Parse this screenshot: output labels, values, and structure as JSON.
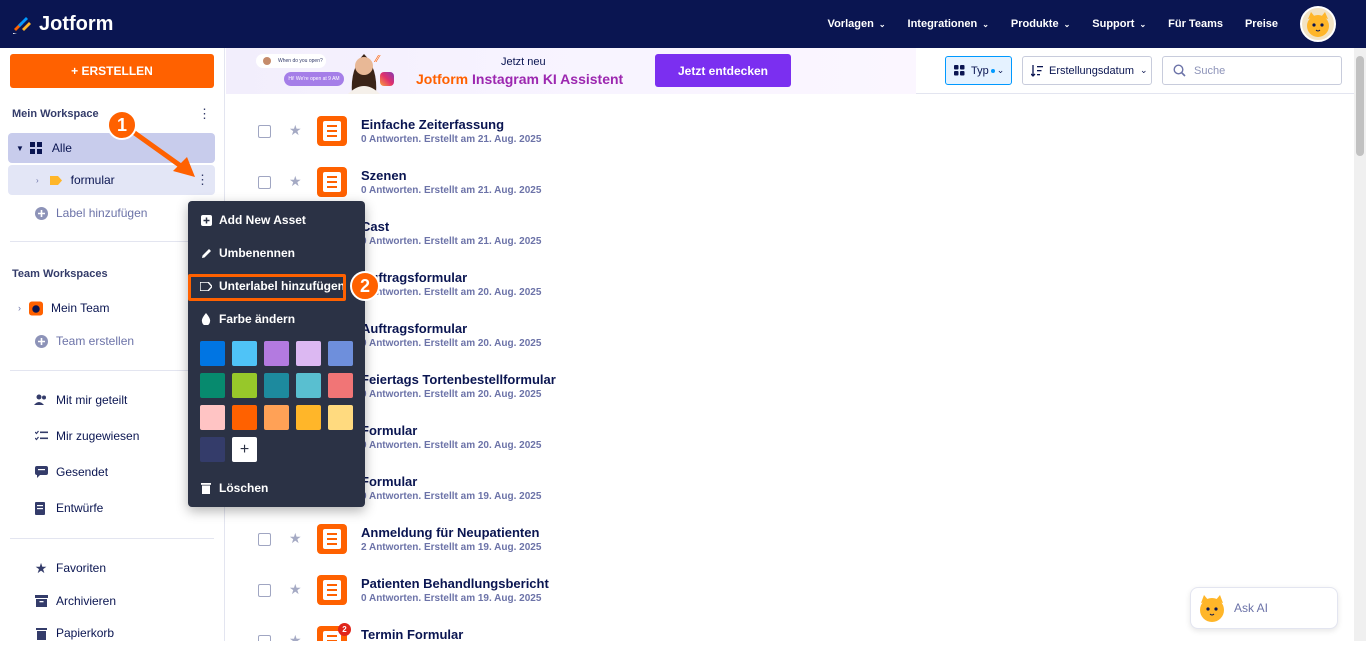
{
  "brand": {
    "name": "Jotform"
  },
  "nav": {
    "links": [
      "Vorlagen",
      "Integrationen",
      "Produkte",
      "Support"
    ],
    "teams": "Für Teams",
    "pricing": "Preise"
  },
  "sidebar": {
    "create_label": "+ ERSTELLEN",
    "my_workspace": "Mein Workspace",
    "all_label": "Alle",
    "formular_label": "formular",
    "add_label": "Label hinzufügen",
    "team_workspaces": "Team Workspaces",
    "my_team": "Mein Team",
    "create_team": "Team erstellen",
    "shared": "Mit mir geteilt",
    "assigned": "Mir zugewiesen",
    "sent": "Gesendet",
    "drafts": "Entwürfe",
    "favorites": "Favoriten",
    "archive": "Archivieren",
    "trash": "Papierkorb"
  },
  "banner": {
    "new_label": "Jetzt neu",
    "title_a": "Jotform",
    "title_b": "Instagram KI Assistent",
    "cta": "Jetzt entdecken",
    "bubble1": "When do you open?",
    "bubble2": "Hi! We're open at 9 AM"
  },
  "toolbar": {
    "type_label": "Typ",
    "sort_label": "Erstellungsdatum",
    "search_placeholder": "Suche"
  },
  "forms": [
    {
      "title": "Einfache Zeiterfassung",
      "sub": "0 Antworten. Erstellt am 21. Aug. 2025"
    },
    {
      "title": "Szenen",
      "sub": "0 Antworten. Erstellt am 21. Aug. 2025"
    },
    {
      "title": "Cast",
      "sub": "0 Antworten. Erstellt am 21. Aug. 2025"
    },
    {
      "title": "Auftragsformular",
      "sub": "0 Antworten. Erstellt am 20. Aug. 2025"
    },
    {
      "title": "Auftragsformular",
      "sub": "0 Antworten. Erstellt am 20. Aug. 2025"
    },
    {
      "title": "Feiertags Tortenbestellformular",
      "sub": "0 Antworten. Erstellt am 20. Aug. 2025"
    },
    {
      "title": "Formular",
      "sub": "0 Antworten. Erstellt am 20. Aug. 2025"
    },
    {
      "title": "Formular",
      "sub": "0 Antworten. Erstellt am 19. Aug. 2025"
    },
    {
      "title": "Anmeldung für Neupatienten",
      "sub": "2 Antworten. Erstellt am 19. Aug. 2025"
    },
    {
      "title": "Patienten Behandlungsbericht",
      "sub": "0 Antworten. Erstellt am 19. Aug. 2025"
    },
    {
      "title": "Termin Formular",
      "sub": ""
    }
  ],
  "notification_count": "2",
  "context_menu": {
    "add_asset": "Add New Asset",
    "rename": "Umbenennen",
    "add_sublabel": "Unterlabel hinzufügen",
    "change_color": "Farbe ändern",
    "add_color": "+",
    "delete": "Löschen",
    "colors": [
      "#0075e3",
      "#4fc3f7",
      "#b37ae0",
      "#dcb8f2",
      "#6e8fdc",
      "#078a6e",
      "#97c82a",
      "#1d8a9e",
      "#59bfd0",
      "#f17576",
      "#ffc4c4",
      "#ff6100",
      "#ffa156",
      "#ffb629",
      "#ffda7f",
      "#343c6a"
    ]
  },
  "badges": {
    "one": "1",
    "two": "2"
  },
  "askai": {
    "label": "Ask AI"
  },
  "colors": {
    "nav_bg": "#0a1551",
    "accent": "#ff6100",
    "purple": "#7b2ff0"
  }
}
